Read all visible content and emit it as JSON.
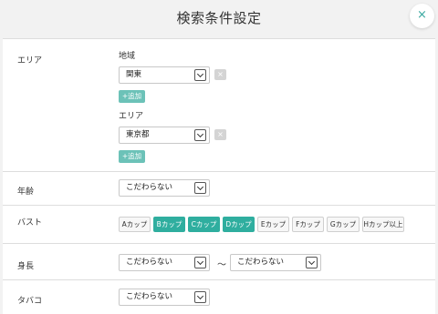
{
  "header": {
    "title": "検索条件設定",
    "close_label": "×"
  },
  "area": {
    "label": "エリア",
    "region_label": "地域",
    "region_value": "関東",
    "add_label": "+追加",
    "remove_label": "×",
    "area_label": "エリア",
    "area_value": "東京都"
  },
  "age": {
    "label": "年齢",
    "value": "こだわらない"
  },
  "bust": {
    "label": "バスト",
    "options": [
      {
        "label": "Aカップ",
        "selected": false
      },
      {
        "label": "Bカップ",
        "selected": true
      },
      {
        "label": "Cカップ",
        "selected": true
      },
      {
        "label": "Dカップ",
        "selected": true
      },
      {
        "label": "Eカップ",
        "selected": false
      },
      {
        "label": "Fカップ",
        "selected": false
      },
      {
        "label": "Gカップ",
        "selected": false
      },
      {
        "label": "Hカップ以上",
        "selected": false
      }
    ]
  },
  "height": {
    "label": "身長",
    "min_value": "こだわらない",
    "separator": "〜",
    "max_value": "こだわらない"
  },
  "tobacco": {
    "label": "タバコ",
    "value": "こだわらない"
  },
  "colors": {
    "accent": "#2fae9f",
    "add_button": "#6cc2b8",
    "close_icon": "#3aa8a0"
  }
}
